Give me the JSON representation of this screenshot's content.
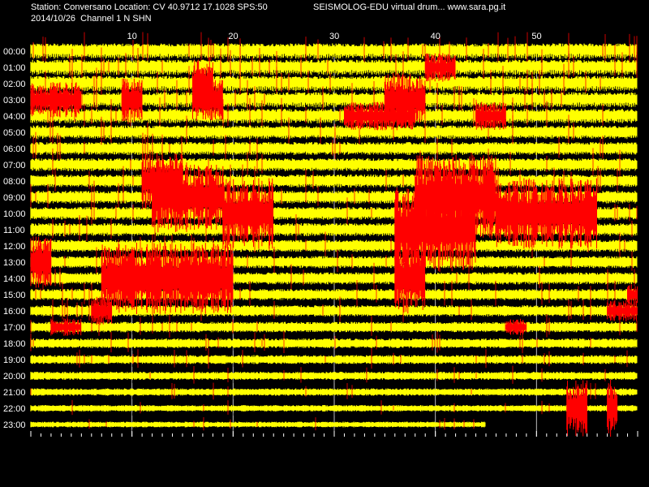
{
  "header": {
    "station": "Station: Conversano Location: CV 40.9712 17.1028 SPS:50",
    "title": "SEISMOLOG-EDU virtual drum... www.sara.pg.it",
    "date_channel": "2014/10/26  Channel 1 N SHN"
  },
  "chart_data": {
    "type": "helicorder",
    "minute_ticks": [
      10,
      20,
      30,
      40,
      50
    ],
    "xlim": [
      0,
      60
    ],
    "hours": [
      "00:00",
      "01:00",
      "02:00",
      "03:00",
      "04:00",
      "05:00",
      "06:00",
      "07:00",
      "08:00",
      "09:00",
      "10:00",
      "11:00",
      "12:00",
      "13:00",
      "14:00",
      "15:00",
      "16:00",
      "17:00",
      "18:00",
      "19:00",
      "20:00",
      "21:00",
      "22:00",
      "23:00"
    ],
    "trace_colors": [
      "#ffff00",
      "#000000",
      "#ff0000"
    ],
    "grid_color": "#ffffff",
    "background": "#000000",
    "last_trace_end_minute": 45,
    "row_noise_level": [
      0.95,
      0.95,
      0.95,
      0.95,
      0.9,
      0.85,
      0.8,
      0.8,
      0.8,
      0.8,
      0.8,
      0.8,
      0.75,
      0.75,
      0.75,
      0.7,
      0.7,
      0.65,
      0.6,
      0.55,
      0.5,
      0.45,
      0.4,
      0.35
    ],
    "events": [
      {
        "hour": "03:00",
        "start_min": 0,
        "end_min": 5,
        "amp": 1.0
      },
      {
        "hour": "03:00",
        "start_min": 9,
        "end_min": 11,
        "amp": 1.2
      },
      {
        "hour": "03:00",
        "start_min": 16,
        "end_min": 19,
        "amp": 1.2
      },
      {
        "hour": "02:00",
        "start_min": 16,
        "end_min": 18,
        "amp": 1.5
      },
      {
        "hour": "04:00",
        "start_min": 31,
        "end_min": 38,
        "amp": 0.8
      },
      {
        "hour": "03:00",
        "start_min": 35,
        "end_min": 39,
        "amp": 1.5
      },
      {
        "hour": "01:00",
        "start_min": 39,
        "end_min": 42,
        "amp": 0.8
      },
      {
        "hour": "04:00",
        "start_min": 44,
        "end_min": 47,
        "amp": 0.8
      },
      {
        "hour": "08:00",
        "start_min": 11,
        "end_min": 15,
        "amp": 1.6
      },
      {
        "hour": "09:00",
        "start_min": 12,
        "end_min": 19,
        "amp": 2.0
      },
      {
        "hour": "10:00",
        "start_min": 19,
        "end_min": 24,
        "amp": 2.0
      },
      {
        "hour": "09:00",
        "start_min": 38,
        "end_min": 46,
        "amp": 2.4
      },
      {
        "hour": "10:00",
        "start_min": 46,
        "end_min": 56,
        "amp": 2.0
      },
      {
        "hour": "11:00",
        "start_min": 36,
        "end_min": 44,
        "amp": 2.4
      },
      {
        "hour": "13:00",
        "start_min": 0,
        "end_min": 2,
        "amp": 1.5
      },
      {
        "hour": "14:00",
        "start_min": 7,
        "end_min": 20,
        "amp": 2.0
      },
      {
        "hour": "14:00",
        "start_min": 36,
        "end_min": 39,
        "amp": 2.0
      },
      {
        "hour": "16:00",
        "start_min": 6,
        "end_min": 8,
        "amp": 0.8
      },
      {
        "hour": "17:00",
        "start_min": 2,
        "end_min": 5,
        "amp": 0.5
      },
      {
        "hour": "17:00",
        "start_min": 47,
        "end_min": 49,
        "amp": 0.5
      },
      {
        "hour": "16:00",
        "start_min": 57,
        "end_min": 60,
        "amp": 0.6
      },
      {
        "hour": "15:00",
        "start_min": 59,
        "end_min": 60,
        "amp": 0.6
      },
      {
        "hour": "22:00",
        "start_min": 53,
        "end_min": 55,
        "amp": 1.6
      },
      {
        "hour": "22:00",
        "start_min": 57,
        "end_min": 58,
        "amp": 1.6
      }
    ]
  }
}
